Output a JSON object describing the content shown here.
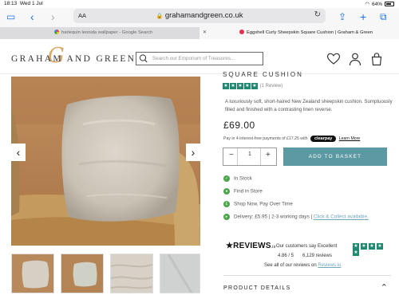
{
  "status_bar": {
    "time": "18:13",
    "date": "Wed 1 Jul",
    "battery": "64%"
  },
  "browser": {
    "text_size_label": "AA",
    "url": "grahamandgreen.co.uk",
    "tabs": [
      {
        "title": "harlequin leonida wallpaper - Google Search",
        "active": false
      },
      {
        "title": "Eggshell Curly Sheepskin Square Cushion | Graham & Green",
        "active": true
      }
    ]
  },
  "header": {
    "logo_text": "GRAHAM AND GREEN",
    "logo_mark": "G",
    "search_placeholder": "Search our Emporium of Treasures..."
  },
  "product": {
    "title_fragment": "SQUARE CUSHION",
    "rating_stars": 5,
    "review_count_text": "(1 Review)",
    "description": "A luxuriously soft, short-haired New Zealand sheepskin cushion. Sumptuously filled and finished with a contrasting linen reverse.",
    "price": "£69.00",
    "pay_in_4_text": "Pay in 4 interest-free payments of £17.25 with",
    "clearpay_label": "clearpay",
    "learn_more": "Learn More",
    "quantity": "1",
    "minus": "−",
    "plus": "+",
    "add_to_basket": "ADD TO BASKET",
    "features": [
      {
        "icon": "check-icon",
        "text": "In Stock"
      },
      {
        "icon": "location-pin-icon",
        "text": "Find in Store"
      },
      {
        "icon": "clearpay-icon",
        "text": "Shop Now, Pay Over Time"
      },
      {
        "icon": "truck-icon",
        "text": "Delivery: £5.95 | 2-3 working days | ",
        "link": "Click & Collect available."
      }
    ]
  },
  "reviews": {
    "brand": "REVIEWS",
    "brand_suffix": ".io",
    "headline": "Our customers say Excellent",
    "score": "4.86 / 5",
    "count_text": "6,129 reviews",
    "see_all": "See all of our reviews on",
    "see_all_link": "Reviews.io"
  },
  "details": {
    "label": "PRODUCT DETAILS"
  },
  "colors": {
    "accent": "#5c9aa3",
    "star": "#1f8a70",
    "in_stock": "#49a64a",
    "link": "#6ea6c0",
    "logo_gold": "#d49a4b"
  }
}
